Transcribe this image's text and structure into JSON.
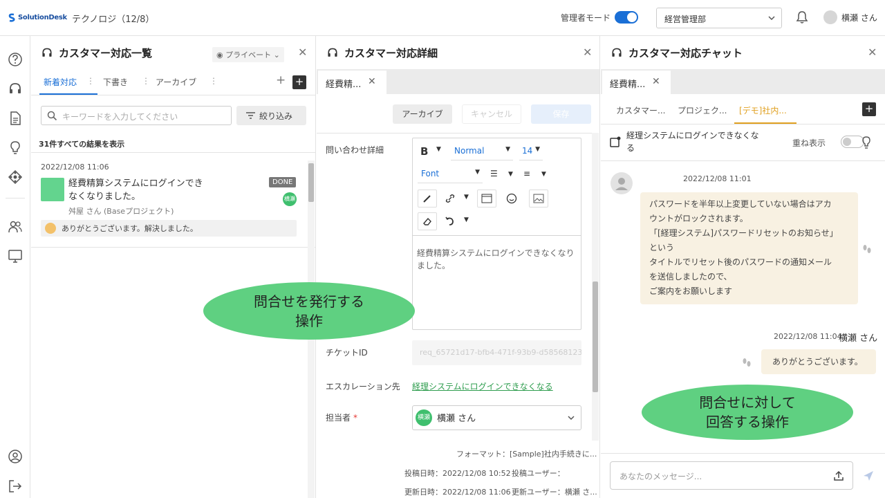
{
  "app": {
    "brand": "SolutionDesk",
    "company_label": "テクノロジ（12/8）"
  },
  "header": {
    "admin_mode_label": "管理者モード",
    "admin_mode_on": true,
    "department": "経営管理部",
    "user_name": "横瀬 さん"
  },
  "list_pane": {
    "title": "カスタマー対応一覧",
    "visibility": "プライベート",
    "tabs": [
      {
        "label": "新着対応"
      },
      {
        "label": "下書き"
      },
      {
        "label": "アーカイブ"
      }
    ],
    "search_placeholder": "キーワードを入力してください",
    "filter_label": "絞り込み",
    "result_count": "31件すべての結果を表示",
    "items": [
      {
        "date": "2022/12/08 11:06",
        "title": "経費精算システムにログインできなくなりました。",
        "status": "DONE",
        "assignee_badge": "横瀬",
        "project": "舛屋 さん (Baseプロジェクト)",
        "last_comment": "ありがとうございます。解決しました。"
      }
    ]
  },
  "detail_pane": {
    "title": "カスタマー対応詳細",
    "tab_label": "経費精...",
    "buttons": {
      "archive": "アーカイブ",
      "cancel": "キャンセル",
      "save": "保存"
    },
    "fields": {
      "detail_label": "問い合わせ詳細",
      "editor": {
        "font_style": "Normal",
        "font_size": "14",
        "font_family": "Font",
        "bold": "B",
        "content": "経費精算システムにログインできなくなりました。"
      },
      "ticket_label": "チケットID",
      "ticket_value": "req_65721d17-bfb4-471f-93b9-d58568123",
      "escalation_label": "エスカレーション先",
      "escalation_link": "経理システムにログインできなくなる",
      "assignee_label": "担当者",
      "required_mark": "*",
      "assignee_badge": "横瀬",
      "assignee_name": "横瀬 さん"
    },
    "meta": {
      "format": "フォーマット：[Sample]社内手続きに...",
      "posted_at": "投稿日時：2022/12/08 10:52",
      "poster": "投稿ユーザー：",
      "updated_at": "更新日時：2022/12/08 11:06",
      "updater": "更新ユーザー：横瀬 さ..."
    }
  },
  "chat_pane": {
    "title": "カスタマー対応チャット",
    "tab_label": "経費精...",
    "subtabs": [
      {
        "label": "カスタマー..."
      },
      {
        "label": "プロジェク..."
      },
      {
        "label": "[デモ]社内..."
      }
    ],
    "thread_title": "経理システムにログインできなくなる",
    "overlay_label": "重ね表示",
    "messages": [
      {
        "time": "2022/12/08 11:01",
        "lines": [
          "パスワードを半年以上変更していない場合はアカ",
          "ウントがロックされます。",
          "「[経理システム]パスワードリセットのお知らせ」",
          "という",
          "タイトルでリセット後のパスワードの通知メール",
          "を送信しましたので、",
          "ご案内をお願いします"
        ]
      },
      {
        "time": "2022/12/08 11:04",
        "sender": "横瀬 さん",
        "text": "ありがとうございます。"
      }
    ],
    "input_placeholder": "あなたのメッセージ..."
  },
  "annotations": [
    {
      "lines": [
        "問合せを発行する",
        "操作"
      ],
      "color": "#5fd081"
    },
    {
      "lines": [
        "問合せに対して",
        "回答する操作"
      ],
      "color": "#5fd081"
    }
  ],
  "colors": {
    "accent": "#1a6fd6",
    "chat_accent": "#e0a020",
    "bubble": "#f8f1e2",
    "link": "#2e9d4e"
  }
}
